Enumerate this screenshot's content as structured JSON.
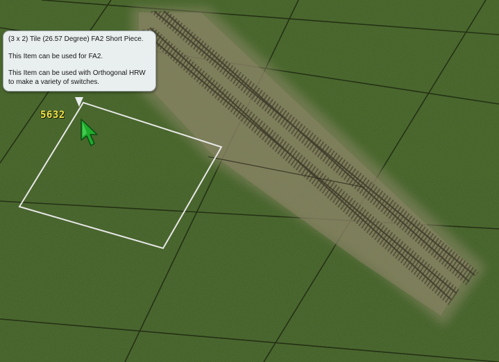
{
  "tooltip": {
    "title": "(3 x 2) Tile (26.57 Degree) FA2 Short Piece.",
    "line2": "This Item can be used for FA2.",
    "line3a": "This Item can be used with Orthogonal HRW",
    "line3b": "to make a variety of switches."
  },
  "price": "5632",
  "cursor": {
    "icon": "arrow-pointer-icon",
    "color": "#1faa2c"
  },
  "colors": {
    "grass": "#3f5a22",
    "grid": "#1f2a10",
    "track_bed": "#8a8466",
    "selection": "#e6e6e6"
  }
}
